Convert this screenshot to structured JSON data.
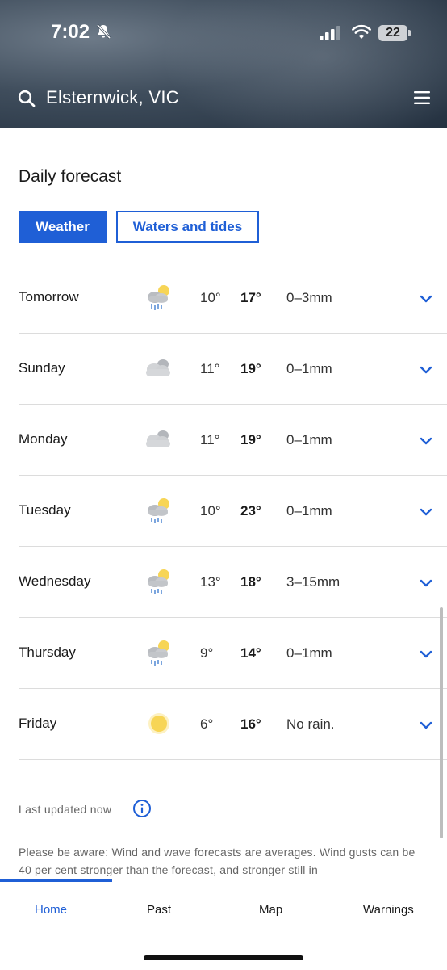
{
  "status_bar": {
    "time": "7:02",
    "battery": "22"
  },
  "header": {
    "location": "Elsternwick, VIC"
  },
  "section": {
    "title": "Daily forecast"
  },
  "tabs": {
    "weather": "Weather",
    "tides": "Waters and tides"
  },
  "forecast": [
    {
      "day": "Tomorrow",
      "icon": "showers-sun-icon",
      "min": "10°",
      "max": "17°",
      "rain": "0–3mm"
    },
    {
      "day": "Sunday",
      "icon": "cloudy-icon",
      "min": "11°",
      "max": "19°",
      "rain": "0–1mm"
    },
    {
      "day": "Monday",
      "icon": "cloudy-icon",
      "min": "11°",
      "max": "19°",
      "rain": "0–1mm"
    },
    {
      "day": "Tuesday",
      "icon": "showers-sun-icon",
      "min": "10°",
      "max": "23°",
      "rain": "0–1mm"
    },
    {
      "day": "Wednesday",
      "icon": "showers-sun-icon",
      "min": "13°",
      "max": "18°",
      "rain": "3–15mm"
    },
    {
      "day": "Thursday",
      "icon": "showers-sun-icon",
      "min": "9°",
      "max": "14°",
      "rain": "0–1mm"
    },
    {
      "day": "Friday",
      "icon": "sunny-icon",
      "min": "6°",
      "max": "16°",
      "rain": "No rain."
    }
  ],
  "footer": {
    "updated": "Last updated now",
    "notice": "Please be aware: Wind and wave forecasts are averages. Wind gusts can be 40 per cent stronger than the forecast, and stronger still in"
  },
  "nav": {
    "home": "Home",
    "past": "Past",
    "map": "Map",
    "warnings": "Warnings"
  },
  "colors": {
    "accent": "#1f5fd6",
    "sun": "#f7d556",
    "cloud": "#c9cbcf",
    "rain": "#5b8fd6"
  }
}
